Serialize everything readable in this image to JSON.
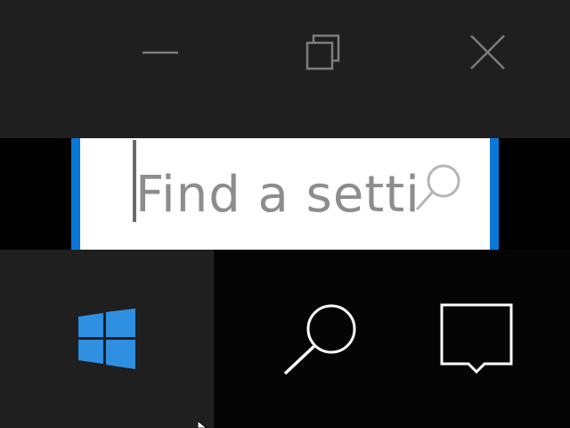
{
  "titlebar": {
    "minimize_icon": "minimize-icon",
    "maximize_icon": "restore-icon",
    "close_icon": "close-icon"
  },
  "search": {
    "placeholder": "Find a settin",
    "value": "",
    "icon": "search-icon"
  },
  "taskbar": {
    "start_icon": "windows-logo-icon",
    "search_icon": "search-icon",
    "action_center_icon": "action-center-icon"
  },
  "colors": {
    "titlebar_bg": "#1f1f1f",
    "accent": "#0a78d7",
    "taskbar_bg": "#050505",
    "start_tile_bg": "#1f1f1f",
    "windows_logo": "#2f8fe0",
    "placeholder_text": "#8d8d8d"
  }
}
